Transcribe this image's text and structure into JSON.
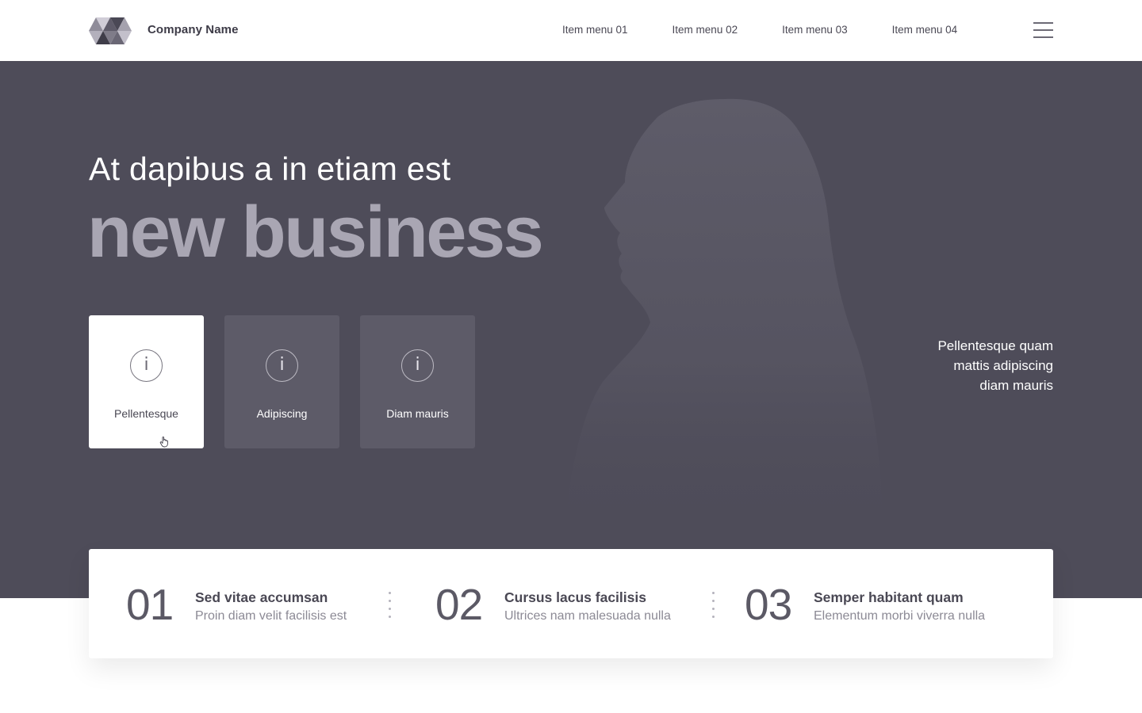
{
  "header": {
    "brand": "Company Name",
    "nav": [
      "Item menu 01",
      "Item menu 02",
      "Item menu 03",
      "Item menu 04"
    ],
    "menu_icon": "hamburger-icon"
  },
  "hero": {
    "subtitle": "At dapibus a in etiam est",
    "title": "new business",
    "cards": [
      {
        "label": "Pellentesque",
        "icon": "info-icon",
        "icon_glyph": "i",
        "active": true
      },
      {
        "label": "Adipiscing",
        "icon": "info-icon",
        "icon_glyph": "i",
        "active": false
      },
      {
        "label": "Diam mauris",
        "icon": "info-icon",
        "icon_glyph": "i",
        "active": false
      }
    ],
    "aside": "Pellentesque quam mattis adipiscing diam mauris",
    "background_image": "woman-silhouette"
  },
  "steps": [
    {
      "number": "01",
      "title": "Sed vitae accumsan",
      "desc": "Proin diam velit facilisis est"
    },
    {
      "number": "02",
      "title": "Cursus lacus facilisis",
      "desc": "Ultrices nam malesuada nulla"
    },
    {
      "number": "03",
      "title": "Semper habitant quam",
      "desc": "Elementum morbi viverra nulla"
    }
  ],
  "colors": {
    "hero_bg": "#4e4c59",
    "hero_title": "#a9a6b3",
    "card_bg": "#5d5b68",
    "card_active_bg": "#ffffff"
  }
}
